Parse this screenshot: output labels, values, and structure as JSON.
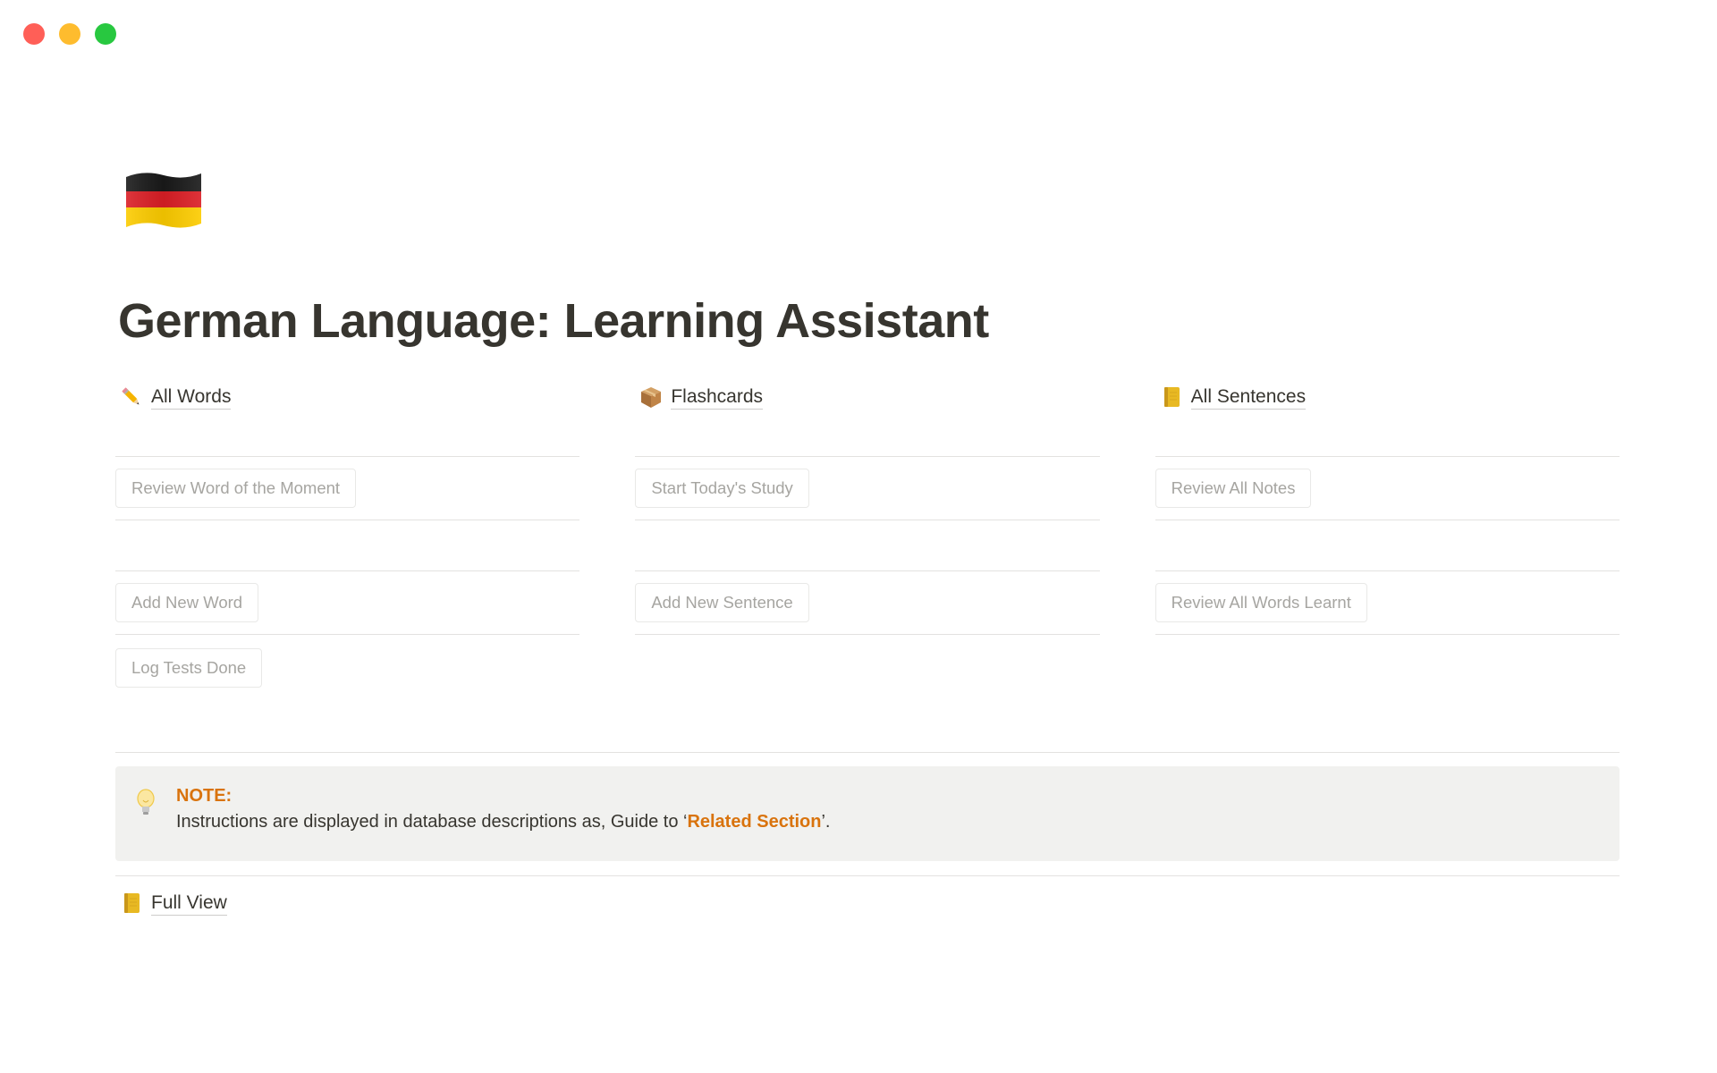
{
  "colors": {
    "accent": "#d9730d",
    "text": "#37352f",
    "muted": "#a6a5a1",
    "callout_bg": "#f1f1ef"
  },
  "window_controls": [
    "close",
    "minimize",
    "maximize"
  ],
  "page": {
    "icon": "german-flag-icon",
    "title": "German Language: Learning Assistant"
  },
  "columns": [
    {
      "link": {
        "icon": "pencil-icon",
        "label": "All Words"
      },
      "buttons": [
        "Review Word of the Moment",
        "Add New Word",
        "Log Tests Done"
      ]
    },
    {
      "link": {
        "icon": "package-icon",
        "label": "Flashcards"
      },
      "buttons": [
        "Start Today's Study",
        "Add New Sentence"
      ]
    },
    {
      "link": {
        "icon": "notebook-icon",
        "label": "All Sentences"
      },
      "buttons": [
        "Review All Notes",
        "Review All Words Learnt"
      ]
    }
  ],
  "callout": {
    "icon": "lightbulb-icon",
    "title": "NOTE:",
    "text_before": "Instructions are displayed in database descriptions as, Guide to ‘",
    "text_accent": "Related Section",
    "text_after": "’."
  },
  "footer_link": {
    "icon": "notebook-icon",
    "label": "Full View"
  }
}
